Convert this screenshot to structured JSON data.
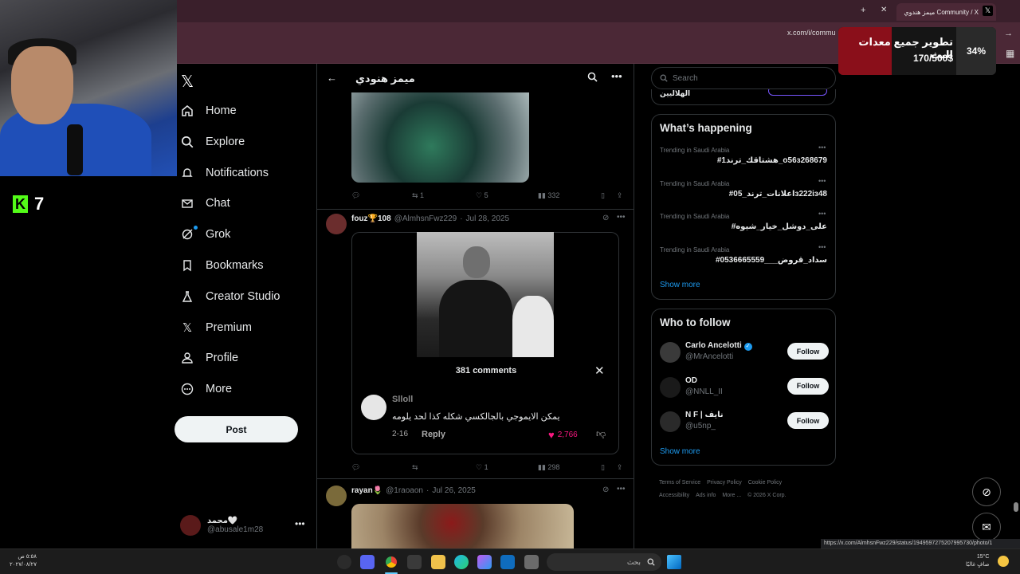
{
  "browser": {
    "tab_title": "ميمز هندوي Community / X",
    "url": "x.com/i/commu",
    "status_url": "https://x.com/AlmhsnFwz229/status/1949597275207995730/photo/1"
  },
  "stream_overlay": {
    "kick_count": "7",
    "donation_title": "تطوير جميع معدات البث",
    "donation_amount": "170/500$",
    "donation_percent": "34%",
    "donation_progress": 0.34
  },
  "nav": {
    "items": [
      {
        "label": "Home",
        "icon": "home-icon"
      },
      {
        "label": "Explore",
        "icon": "search-icon"
      },
      {
        "label": "Notifications",
        "icon": "bell-icon"
      },
      {
        "label": "Chat",
        "icon": "mail-icon"
      },
      {
        "label": "Grok",
        "icon": "grok-icon"
      },
      {
        "label": "Bookmarks",
        "icon": "bookmark-icon"
      },
      {
        "label": "Creator Studio",
        "icon": "flask-icon"
      },
      {
        "label": "Premium",
        "icon": "x-icon"
      },
      {
        "label": "Profile",
        "icon": "person-icon"
      },
      {
        "label": "More",
        "icon": "more-circle-icon"
      }
    ],
    "post_label": "Post",
    "account": {
      "name": "محمد🤍",
      "handle": "@abusale1m28"
    }
  },
  "column": {
    "title": "ميمز هنودي"
  },
  "tweets": [
    {
      "stats": {
        "replies": "",
        "reposts": "1",
        "likes": "5",
        "views": "332"
      }
    },
    {
      "author": "fouz🏆108",
      "handle": "@AlmhsnFwz229",
      "date": "Jul 28, 2025",
      "comments_title": "381 comments",
      "comment": {
        "user": "Slloll",
        "text": "يمكن الايموجي بالجالكسي شكله كذا لحد يلومه",
        "age": "2-16",
        "reply_label": "Reply",
        "likes": "2,766"
      },
      "stats": {
        "replies": "",
        "reposts": "",
        "likes": "1",
        "views": "298"
      }
    },
    {
      "author": "rayan🌷",
      "handle": "@1raoaon",
      "date": "Jul 26, 2025"
    }
  ],
  "right": {
    "search_placeholder": "Search",
    "top_clipped_text": "الهلاليين",
    "whats_happening": "What’s happening",
    "trends": [
      {
        "meta": "Trending in Saudi Arabia",
        "name": "#هشتاقك_ترند1_o56з268679"
      },
      {
        "meta": "Trending in Saudi Arabia",
        "name": "#اعلانات_ترند_05з222iз48"
      },
      {
        "meta": "Trending in Saudi Arabia",
        "name": "#على_دوشل_خيار_شيوه"
      },
      {
        "meta": "Trending in Saudi Arabia",
        "name": "#سداد_قروض___0536665559"
      }
    ],
    "show_more": "Show more",
    "who_to_follow": "Who to follow",
    "follow": [
      {
        "name": "Carlo Ancelotti",
        "handle": "@MrAncelotti",
        "verified": true
      },
      {
        "name": "OD",
        "handle": "@NNLL_II",
        "verified": false
      },
      {
        "name": "N F | نايف",
        "handle": "@u5np_",
        "verified": false
      }
    ],
    "follow_label": "Follow",
    "footer": [
      "Terms of Service",
      "Privacy Policy",
      "Cookie Policy",
      "Accessibility",
      "Ads info",
      "More ...",
      "© 2026 X Corp."
    ]
  },
  "taskbar": {
    "search_placeholder": "بحث",
    "temp": "15°C",
    "weather": "صافٍ غالبًا",
    "time": "٥:٥٨ ص",
    "date": "٢٠٢٧/٠٨/٢٧"
  }
}
